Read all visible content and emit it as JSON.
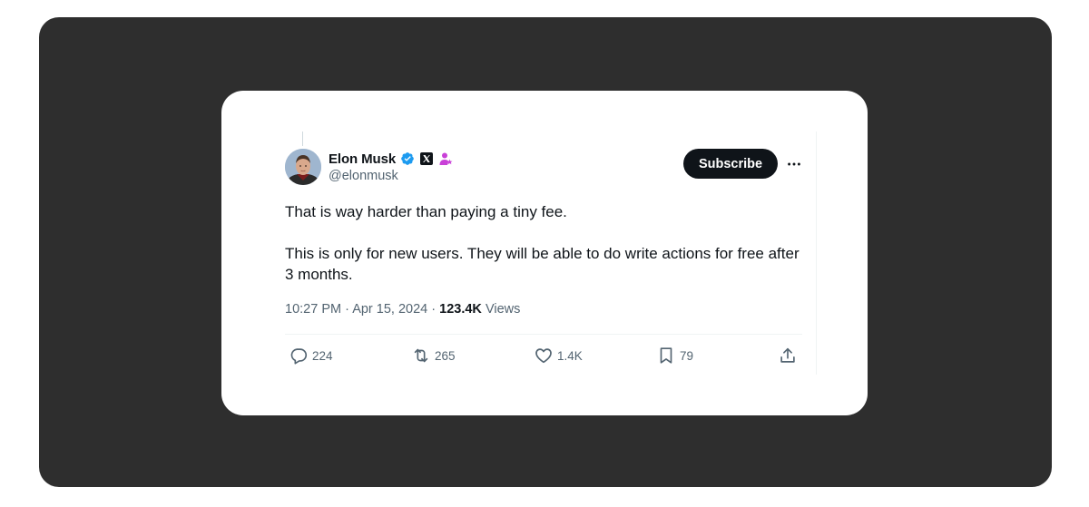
{
  "author": {
    "name": "Elon Musk",
    "handle": "@elonmusk",
    "verified_badge_color": "#1d9bf0",
    "affiliate_badge": "x-logo-icon",
    "subscriber_badge_color": "#c940d8"
  },
  "subscribe_button": {
    "label": "Subscribe"
  },
  "more_button": {
    "label": "More",
    "icon": "more-icon"
  },
  "tweet": {
    "paragraphs": [
      "That is way harder than paying a tiny fee.",
      "This is only for new users. They will be able to do write actions for free after 3 months."
    ]
  },
  "meta": {
    "time": "10:27 PM",
    "separator": "·",
    "date": "Apr 15, 2024",
    "views_count": "123.4K",
    "views_label": "Views"
  },
  "actions": {
    "reply": {
      "icon": "reply-icon",
      "count": "224"
    },
    "repost": {
      "icon": "repost-icon",
      "count": "265"
    },
    "like": {
      "icon": "heart-icon",
      "count": "1.4K"
    },
    "bookmark": {
      "icon": "bookmark-icon",
      "count": "79"
    },
    "share": {
      "icon": "share-icon"
    }
  },
  "colors": {
    "backdrop": "#2e2e2e",
    "card": "#ffffff",
    "text_primary": "#0f1419",
    "text_secondary": "#536471",
    "button_bg": "#0f1419"
  }
}
